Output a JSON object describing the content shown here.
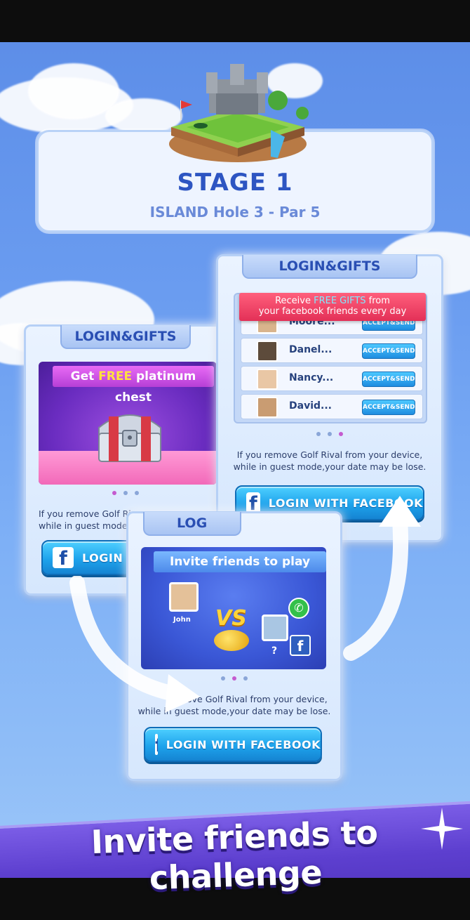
{
  "stage": {
    "title": "STAGE 1",
    "subtitle": "ISLAND Hole 3 - Par 5"
  },
  "card_left": {
    "header": "LOGIN&GIFTS",
    "promo_prefix": "Get ",
    "promo_highlight": "FREE",
    "promo_suffix": " platinum chest",
    "note_line1": "If you remove Golf Ri",
    "note_line2": "while in guest mode",
    "button_label": "LOGIN W"
  },
  "card_right": {
    "header": "LOGIN&GIFTS",
    "ribbon_line1_prefix": "Receive ",
    "ribbon_line1_highlight": "FREE GIFTS",
    "ribbon_line1_suffix": " from",
    "ribbon_line2": "your facebook friends every day",
    "friends": [
      {
        "name": "Moore...",
        "action": "ACCEPT&SEND"
      },
      {
        "name": "Danel...",
        "action": "ACCEPT&SEND"
      },
      {
        "name": "Nancy...",
        "action": "ACCEPT&SEND"
      },
      {
        "name": "David...",
        "action": "ACCEPT&SEND"
      }
    ],
    "note_line1": "If you remove Golf Rival from your device,",
    "note_line2": "while in guest mode,your date may be lose.",
    "button_label": "LOGIN WITH FACEBOOK"
  },
  "card_middle": {
    "header": "LOG",
    "invite_title": "Invite friends to play",
    "player_name": "John",
    "vs_label": "VS",
    "unknown_mark": "?",
    "note_line1": "remove Golf Rival from your device,",
    "note_line2": "while in guest mode,your date may be lose.",
    "button_label": "LOGIN WITH FACEBOOK"
  },
  "fb_letter": "f",
  "banner": {
    "text": "Invite friends to challenge"
  },
  "colors": {
    "sky": "#6a9cf0",
    "title_blue": "#2d55c2",
    "button_blue": "#1ea3ec",
    "banner_purple": "#5d3fcf"
  }
}
